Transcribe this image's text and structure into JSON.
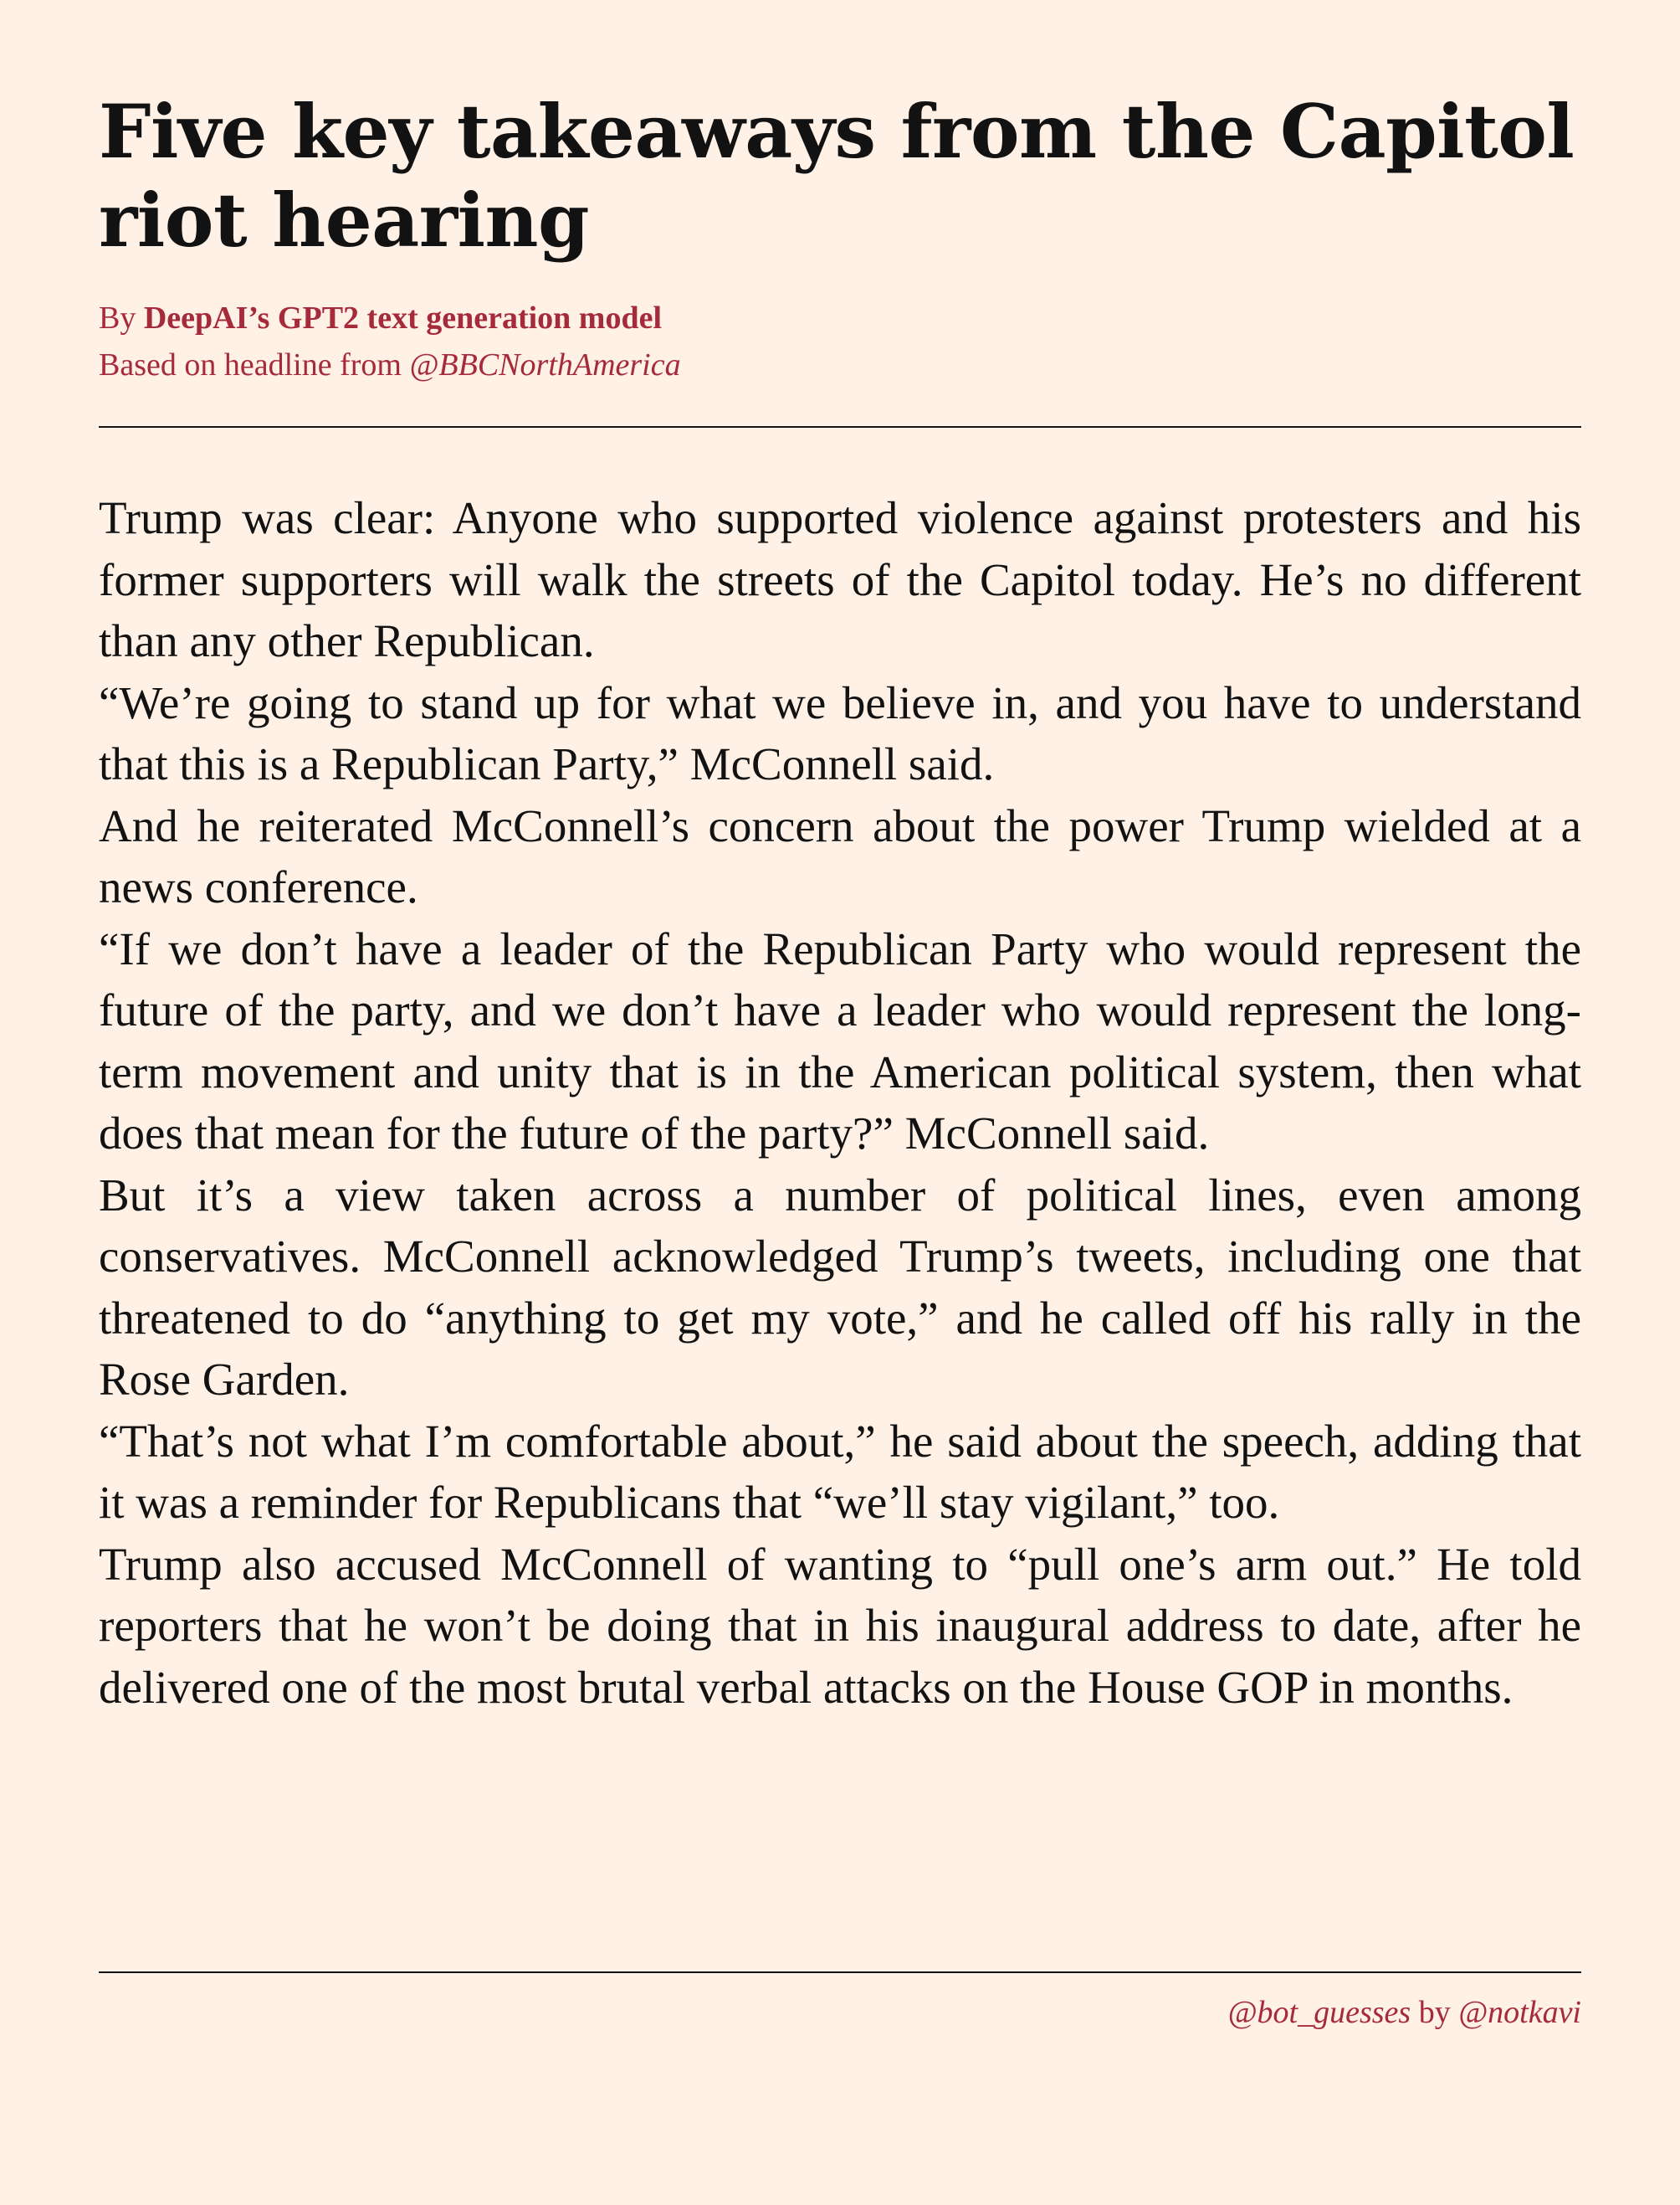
{
  "article": {
    "headline": "Five key takeaways from the Capitol riot hearing",
    "byline": {
      "by_prefix": "By ",
      "author": "DeepAI’s GPT2 text generation model",
      "source_prefix": "Based on headline from ",
      "source_handle": "@BBCNorthAmerica"
    },
    "paragraphs": [
      "Trump was clear: Anyone who supported violence against protesters and his former supporters will walk the streets of the Capitol today. He’s no different than any other Republican.",
      "“We’re going to stand up for what we believe in, and you have to understand that this is a Republican Party,” McConnell said.",
      "And he reiterated McConnell’s concern about the power Trump wielded at a news conference.",
      "“If we don’t have a leader of the Republican Party who would represent the future of the party, and we don’t have a leader who would represent the long-term movement and unity that is in the American political system, then what does that mean for the future of the party?” McConnell said.",
      "But it’s a view taken across a number of political lines, even among conservatives. McConnell acknowledged Trump’s tweets, including one that threatened to do “anything to get my vote,” and he called off his rally in the Rose Garden.",
      "“That’s not what I’m comfortable about,” he said about the speech, adding that it was a reminder for Republicans that “we’ll stay vigilant,” too.",
      "Trump also accused McConnell of wanting to “pull one’s arm out.” He told reporters that he won’t be doing that in his inaugural address to date, after he delivered one of the most brutal verbal attacks on the House GOP in months."
    ]
  },
  "footer": {
    "bot_handle": "@bot_guesses",
    "by_text": " by ",
    "creator_handle": "@notkavi"
  },
  "colors": {
    "background": "#fff1e5",
    "text": "#121212",
    "accent": "#a52a3a"
  }
}
